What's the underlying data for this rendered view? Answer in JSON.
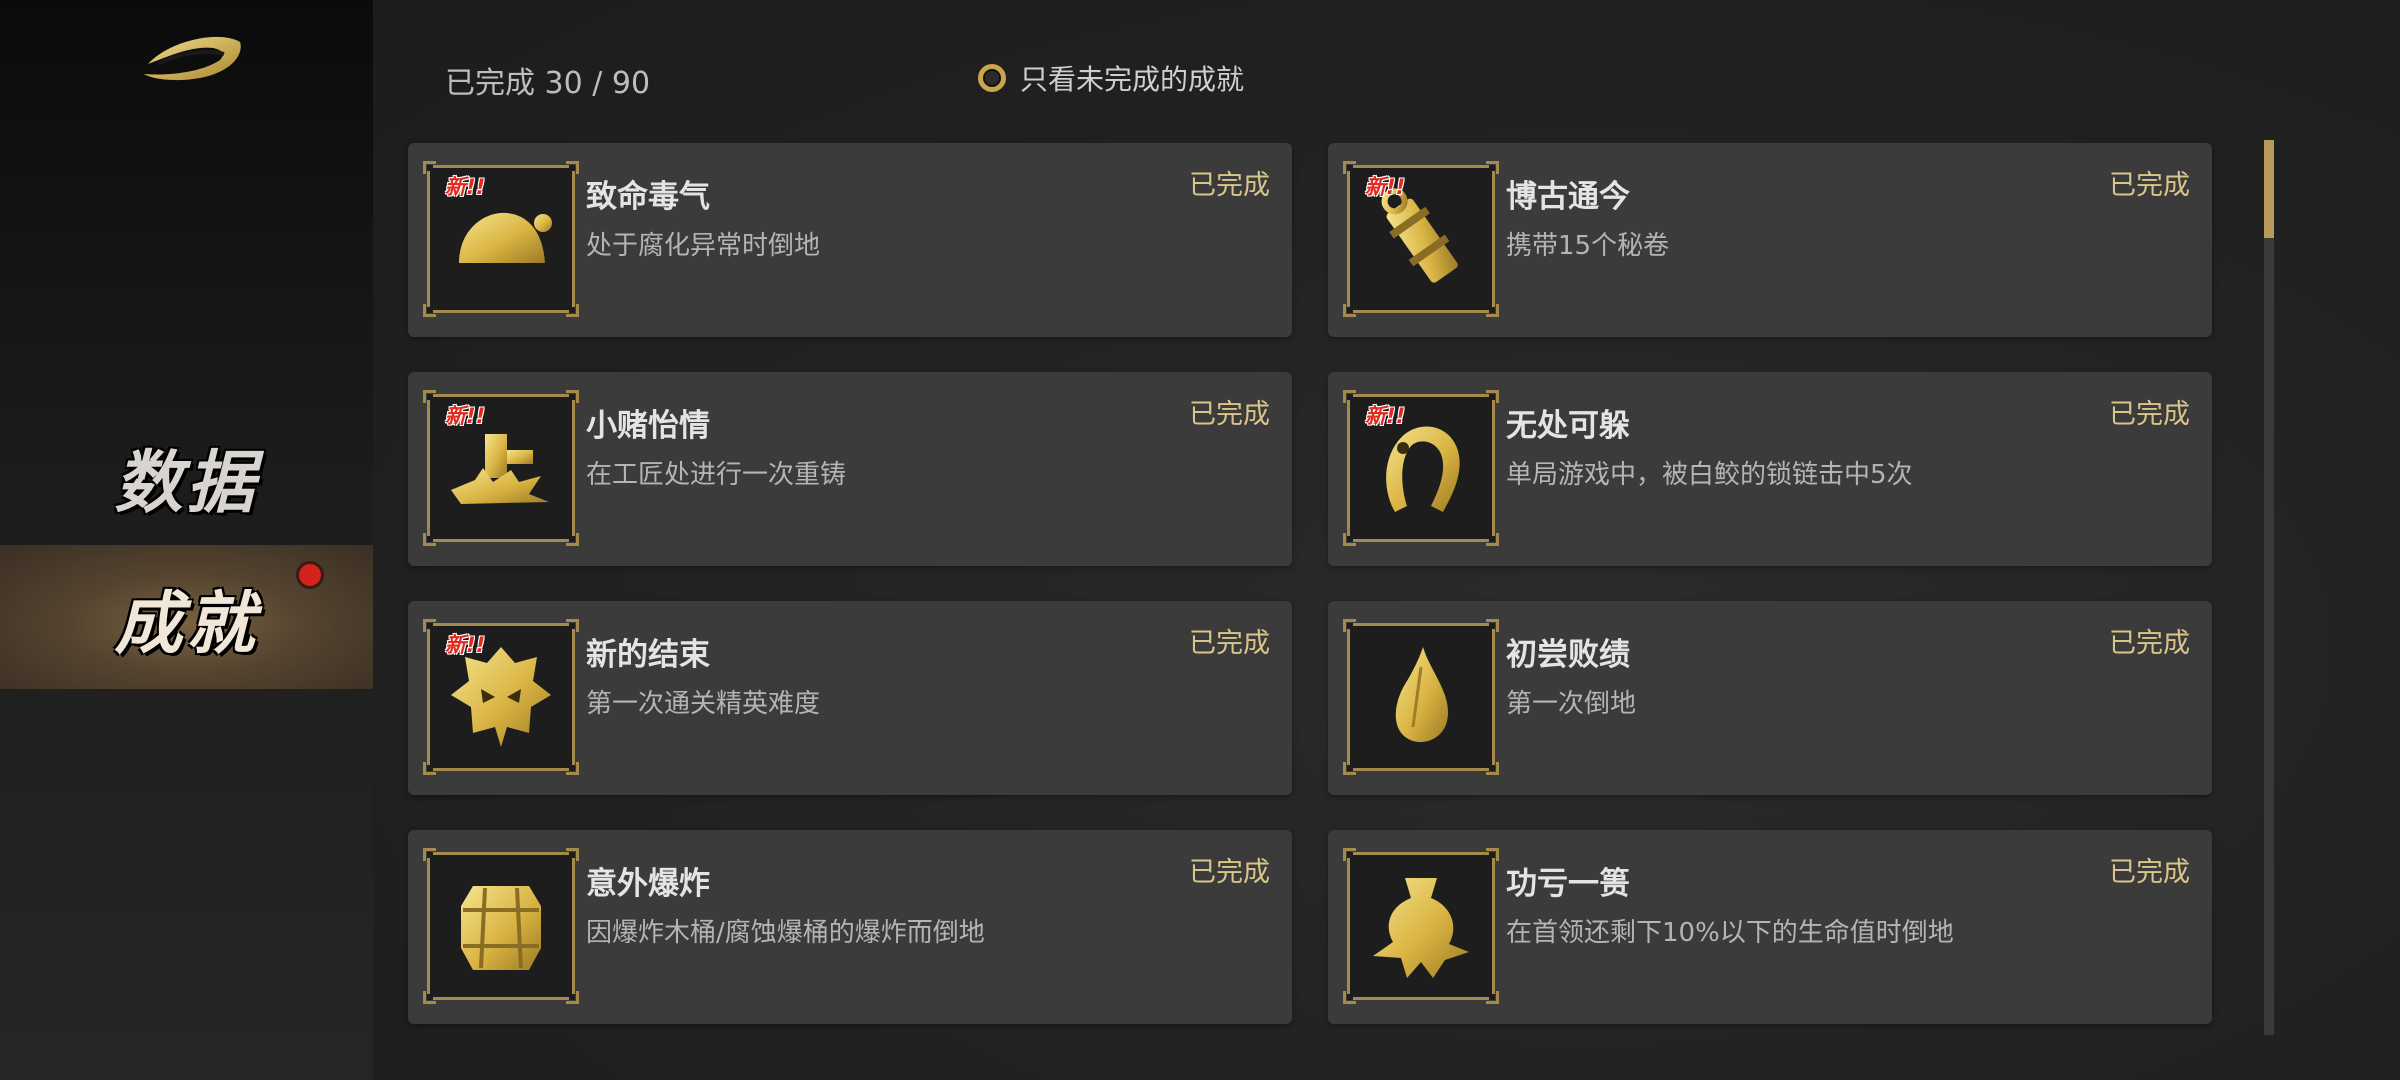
{
  "sidebar": {
    "nav": [
      {
        "label": "数据"
      },
      {
        "label": "成就"
      }
    ]
  },
  "header": {
    "progress": "已完成 30 / 90",
    "filter_label": "只看未完成的成就"
  },
  "achievements": [
    {
      "title": "致命毒气",
      "desc": "处于腐化异常时倒地",
      "status": "已完成",
      "badge": "新!!",
      "icon": "poison-cloud-icon"
    },
    {
      "title": "博古通今",
      "desc": "携带15个秘卷",
      "status": "已完成",
      "badge": "新!!",
      "icon": "scroll-icon"
    },
    {
      "title": "小赌怡情",
      "desc": "在工匠处进行一次重铸",
      "status": "已完成",
      "badge": "新!!",
      "icon": "anvil-hammer-icon"
    },
    {
      "title": "无处可躲",
      "desc": "单局游戏中，被白鲛的锁链击中5次",
      "status": "已完成",
      "badge": "新!!",
      "icon": "chain-hook-icon"
    },
    {
      "title": "新的结束",
      "desc": "第一次通关精英难度",
      "status": "已完成",
      "badge": "新!!",
      "icon": "demon-mask-icon"
    },
    {
      "title": "初尝败绩",
      "desc": "第一次倒地",
      "status": "已完成",
      "badge": "",
      "icon": "drop-icon"
    },
    {
      "title": "意外爆炸",
      "desc": "因爆炸木桶/腐蚀爆桶的爆炸而倒地",
      "status": "已完成",
      "badge": "",
      "icon": "barrel-icon"
    },
    {
      "title": "功亏一篑",
      "desc": "在首领还剩下10%以下的生命值时倒地",
      "status": "已完成",
      "badge": "",
      "icon": "broken-vase-icon"
    }
  ],
  "colors": {
    "gold": "#d9b443",
    "status": "#d9c58a",
    "new_badge": "#e12a1f"
  }
}
